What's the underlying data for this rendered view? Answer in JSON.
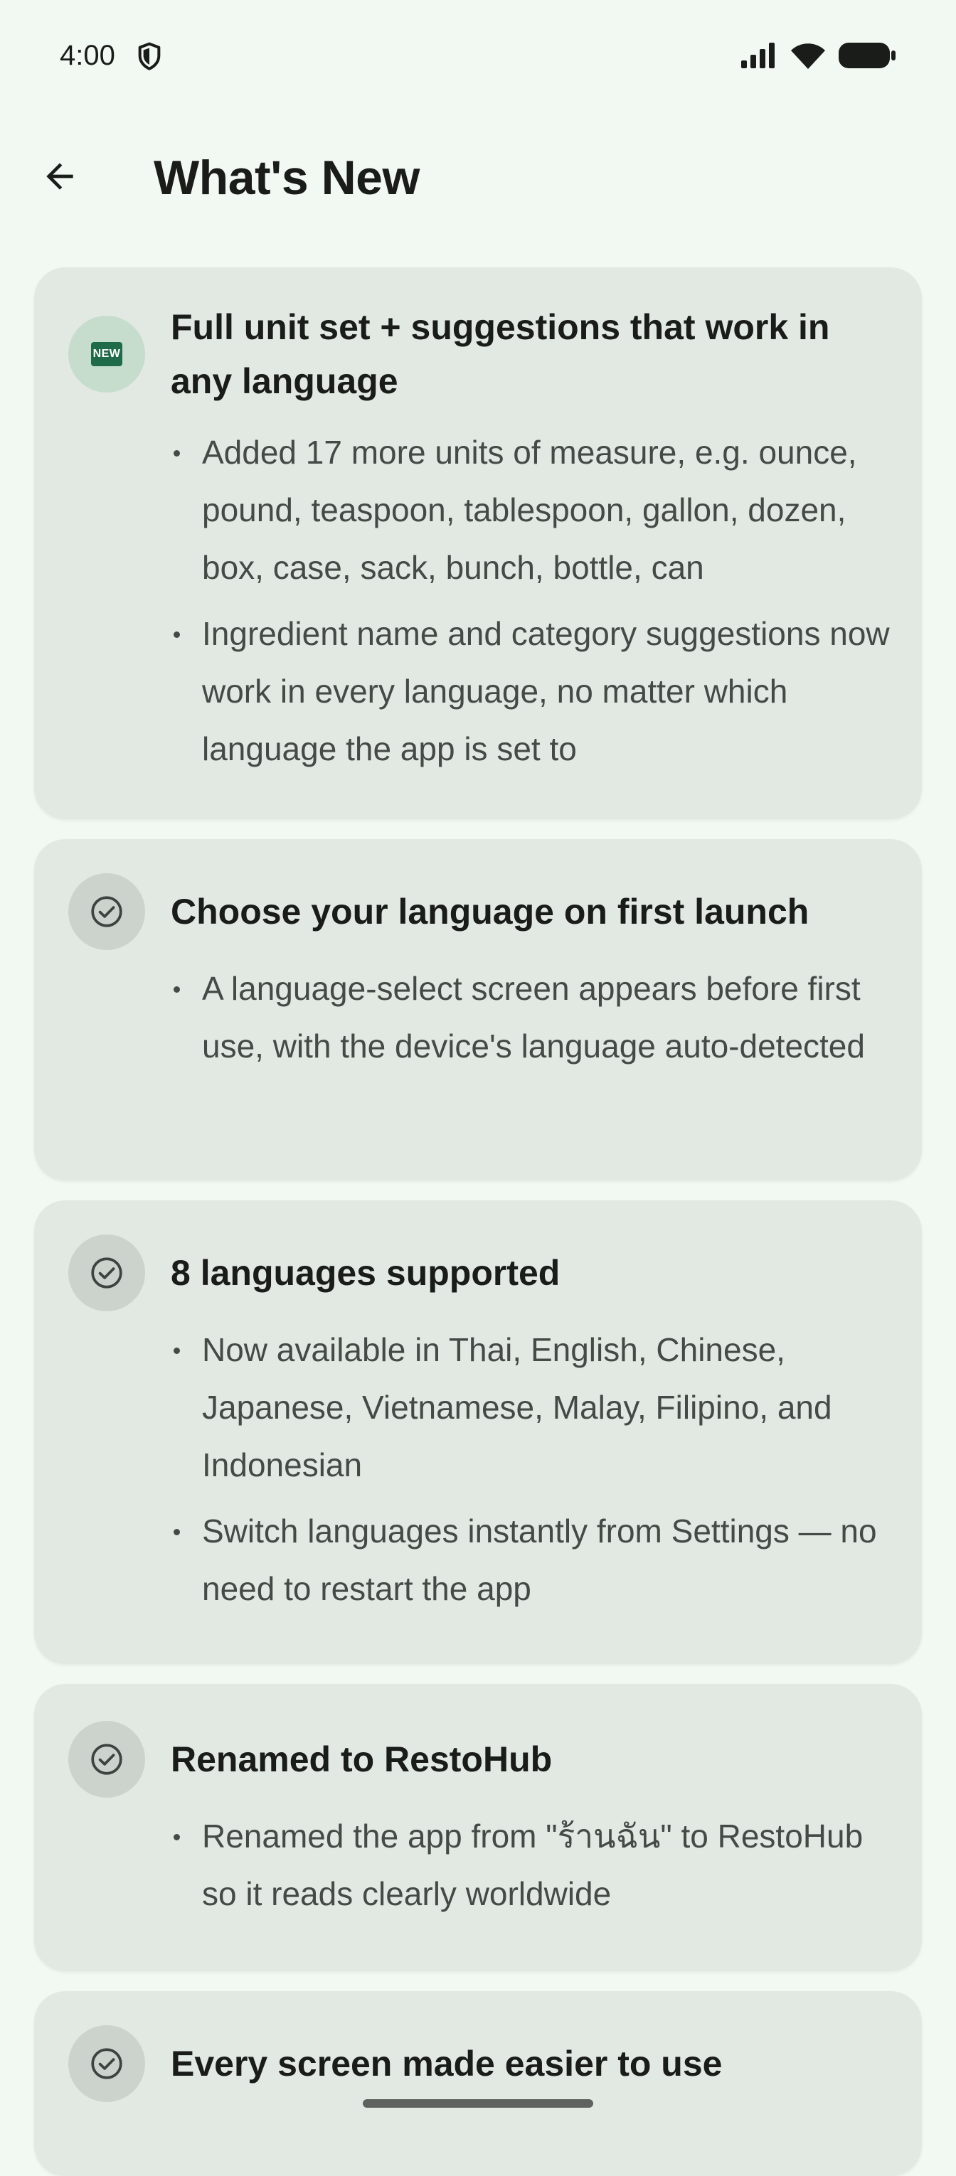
{
  "status_bar": {
    "time": "4:00",
    "icons": [
      "shield-icon",
      "signal-icon",
      "wifi-icon",
      "battery-icon"
    ]
  },
  "app_bar": {
    "back_icon": "arrow-back-icon",
    "title": "What's New"
  },
  "cards": [
    {
      "icon": "new-badge-icon",
      "badge_text": "NEW",
      "title": "Full unit set + suggestions that work in any language",
      "bullets": [
        "Added 17 more units of measure, e.g. ounce, pound, teaspoon, tablespoon, gallon, dozen, box, case, sack, bunch, bottle, can",
        "Ingredient name and category suggestions now work in every language, no matter which language the app is set to"
      ]
    },
    {
      "icon": "check-circle-icon",
      "title": "Choose your language on first launch",
      "bullets": [
        "A language-select screen appears before first use, with the device's language auto-detected"
      ]
    },
    {
      "icon": "check-circle-icon",
      "title": "8 languages supported",
      "bullets": [
        "Now available in Thai, English, Chinese, Japanese, Vietnamese, Malay, Filipino, and Indonesian",
        "Switch languages instantly from Settings — no need to restart the app"
      ]
    },
    {
      "icon": "check-circle-icon",
      "title": "Renamed to RestoHub",
      "bullets": [
        "Renamed the app from \"ร้านฉัน\" to RestoHub so it reads clearly worldwide"
      ]
    },
    {
      "icon": "check-circle-icon",
      "title": "Every screen made easier to use",
      "bullets": []
    }
  ],
  "colors": {
    "background": "#f2f8f2",
    "card": "#e2e9e2",
    "new_badge": "#1f6a49",
    "icon_circle_new": "#c6dccc",
    "icon_circle_check": "#ccd2cc",
    "title_text": "#1a1c1a",
    "body_text": "#454a46"
  }
}
